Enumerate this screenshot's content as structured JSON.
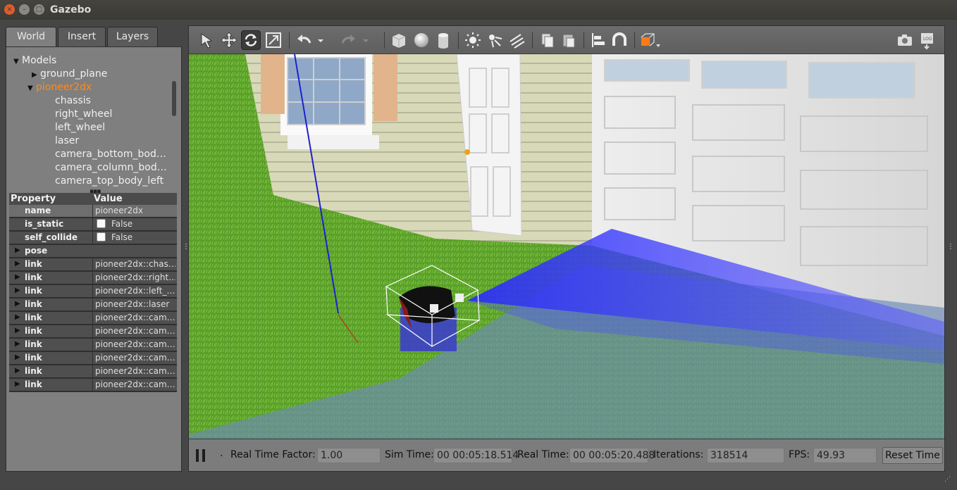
{
  "window": {
    "title": "Gazebo"
  },
  "tabs": [
    "World",
    "Insert",
    "Layers"
  ],
  "tree": {
    "root": "Models",
    "items": [
      {
        "label": "ground_plane",
        "expanded": false,
        "selected": false
      },
      {
        "label": "pioneer2dx",
        "expanded": true,
        "selected": true
      }
    ],
    "children": [
      "chassis",
      "right_wheel",
      "left_wheel",
      "laser",
      "camera_bottom_bod…",
      "camera_column_bod…",
      "camera_top_body_left"
    ]
  },
  "properties": {
    "header_property": "Property",
    "header_value": "Value",
    "rows": [
      {
        "key": "name",
        "value": "pioneer2dx"
      },
      {
        "key": "is_static",
        "value": "False"
      },
      {
        "key": "self_collide",
        "value": "False"
      },
      {
        "key": "pose",
        "value": ""
      },
      {
        "key": "link",
        "value": "pioneer2dx::chas…"
      },
      {
        "key": "link",
        "value": "pioneer2dx::right…"
      },
      {
        "key": "link",
        "value": "pioneer2dx::left_…"
      },
      {
        "key": "link",
        "value": "pioneer2dx::laser"
      },
      {
        "key": "link",
        "value": "pioneer2dx::cam…"
      },
      {
        "key": "link",
        "value": "pioneer2dx::cam…"
      },
      {
        "key": "link",
        "value": "pioneer2dx::cam…"
      },
      {
        "key": "link",
        "value": "pioneer2dx::cam…"
      },
      {
        "key": "link",
        "value": "pioneer2dx::cam…"
      },
      {
        "key": "link",
        "value": "pioneer2dx::cam…"
      }
    ]
  },
  "toolbar": {
    "icons": [
      "select-arrow-icon",
      "translate-icon",
      "rotate-icon",
      "scale-icon",
      "undo-icon",
      "undo-history-icon",
      "redo-icon",
      "redo-history-icon",
      "box-icon",
      "sphere-icon",
      "cylinder-icon",
      "point-light-icon",
      "spot-light-icon",
      "directional-light-icon",
      "copy-icon",
      "paste-icon",
      "align-icon",
      "snap-icon",
      "view-angle-icon",
      "screenshot-icon",
      "log-icon"
    ],
    "active": "rotate-icon"
  },
  "status": {
    "real_time_factor_label": "Real Time Factor:",
    "real_time_factor": "1.00",
    "sim_time_label": "Sim Time:",
    "sim_time": "00 00:05:18.514",
    "real_time_label": "Real Time:",
    "real_time": "00 00:05:20.488",
    "iterations_label": "Iterations:",
    "iterations": "318514",
    "fps_label": "FPS:",
    "fps": "49.93",
    "reset_label": "Reset Time",
    "step_marker": "."
  },
  "colors": {
    "selected": "#ff8a1a",
    "laser": "#3b3bff",
    "grass": "#5aa02c",
    "ground_plane": "#6f8fb5"
  }
}
